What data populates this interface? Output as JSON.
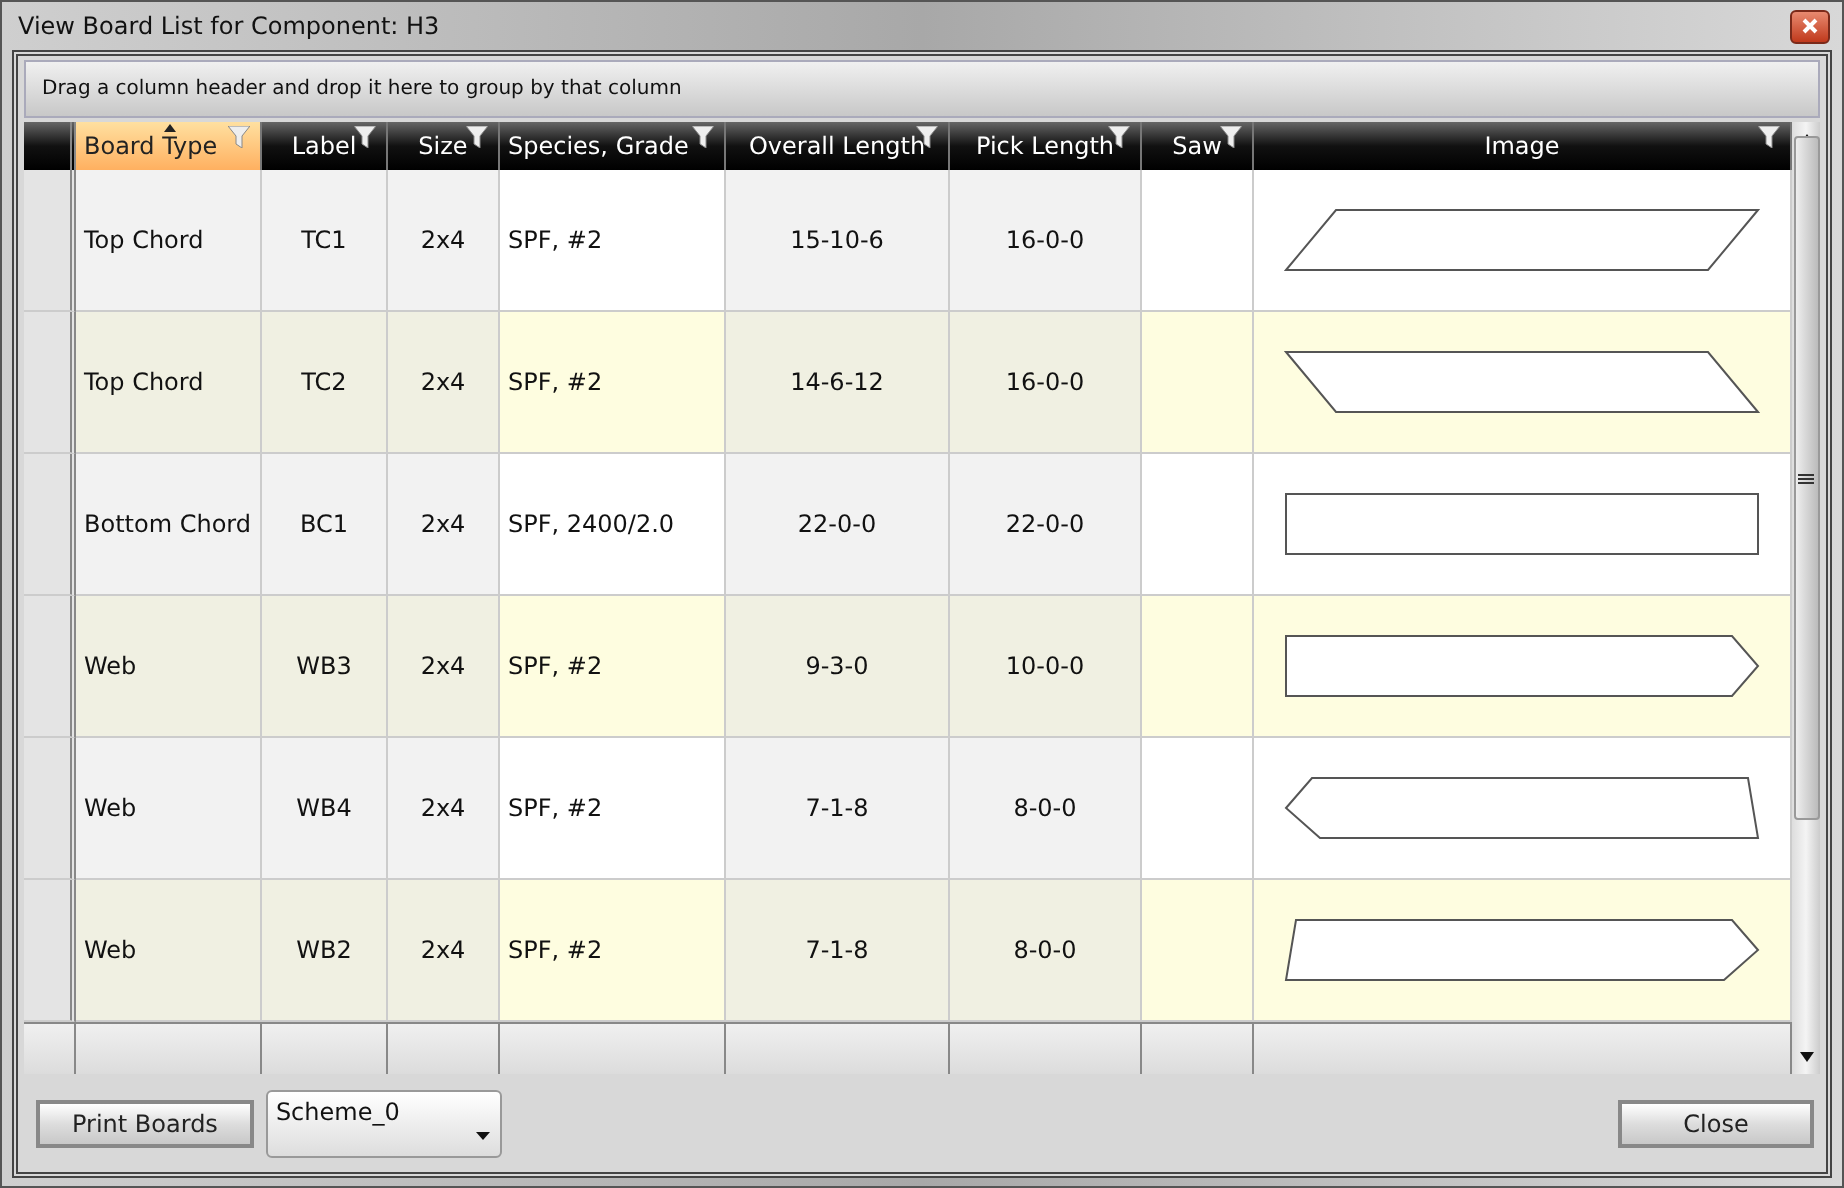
{
  "window": {
    "title": "View Board List for Component: H3"
  },
  "group_panel": {
    "hint": "Drag a column header and drop it here to group by that column"
  },
  "table": {
    "columns": [
      {
        "label": "Board Type",
        "sorted": true
      },
      {
        "label": "Label",
        "sorted": false
      },
      {
        "label": "Size",
        "sorted": false
      },
      {
        "label": "Species, Grade",
        "sorted": false
      },
      {
        "label": "Overall Length",
        "sorted": false
      },
      {
        "label": "Pick Length",
        "sorted": false
      },
      {
        "label": "Saw",
        "sorted": false
      },
      {
        "label": "Image",
        "sorted": false
      }
    ],
    "rows": [
      {
        "cells": [
          "Top Chord",
          "TC1",
          "2x4",
          "SPF, #2",
          "15-10-6",
          "16-0-0",
          ""
        ],
        "image": {
          "kind": "lean-right"
        }
      },
      {
        "cells": [
          "Top Chord",
          "TC2",
          "2x4",
          "SPF, #2",
          "14-6-12",
          "16-0-0",
          ""
        ],
        "image": {
          "kind": "lean-left"
        }
      },
      {
        "cells": [
          "Bottom Chord",
          "BC1",
          "2x4",
          "SPF, 2400/2.0",
          "22-0-0",
          "22-0-0",
          ""
        ],
        "image": {
          "kind": "rect"
        }
      },
      {
        "cells": [
          "Web",
          "WB3",
          "2x4",
          "SPF, #2",
          "9-3-0",
          "10-0-0",
          ""
        ],
        "image": {
          "kind": "point-right"
        }
      },
      {
        "cells": [
          "Web",
          "WB4",
          "2x4",
          "SPF, #2",
          "7-1-8",
          "8-0-0",
          ""
        ],
        "image": {
          "kind": "point-left"
        }
      },
      {
        "cells": [
          "Web",
          "WB2",
          "2x4",
          "SPF, #2",
          "7-1-8",
          "8-0-0",
          ""
        ],
        "image": {
          "kind": "slant-point-right"
        }
      }
    ]
  },
  "footer": {
    "print_button": "Print Boards",
    "scheme": {
      "value": "Scheme_0"
    },
    "close_button": "Close"
  }
}
